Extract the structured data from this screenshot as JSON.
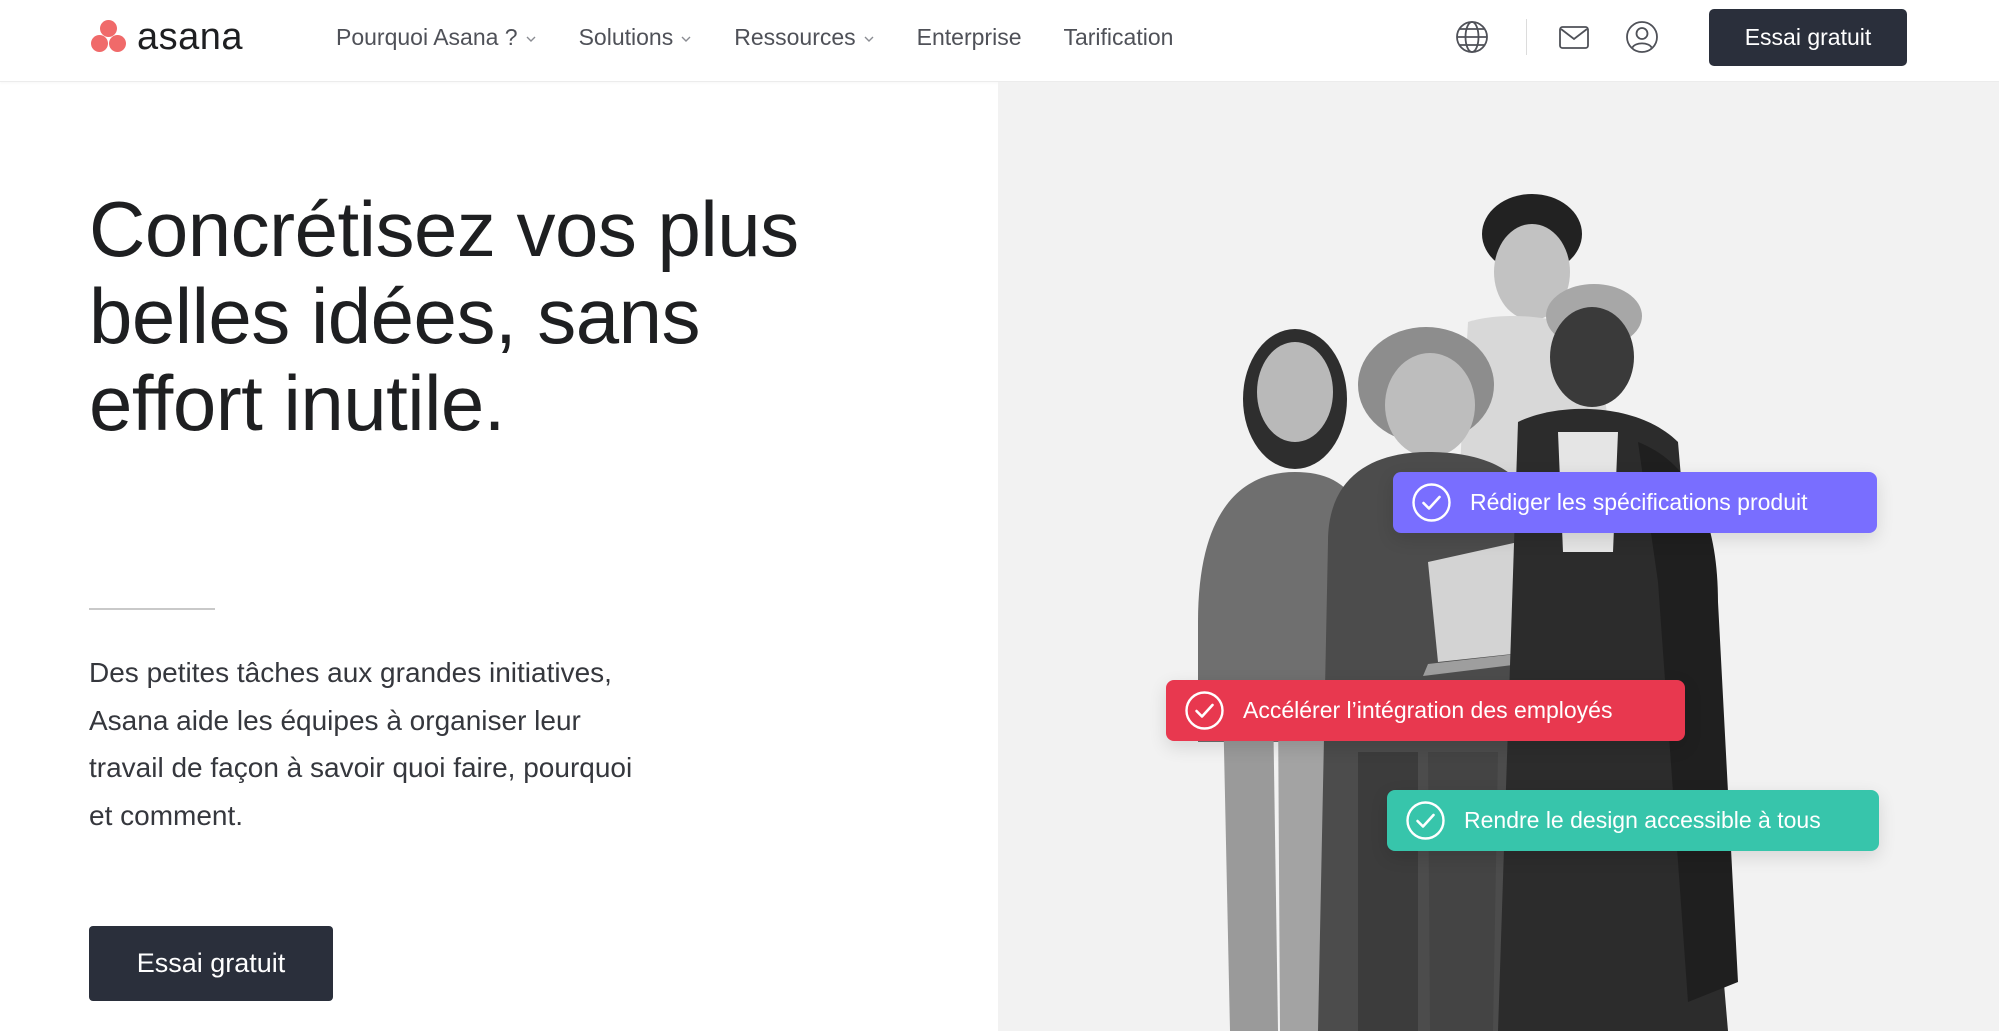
{
  "brand": {
    "name": "asana",
    "accent": "#f06a6a",
    "dark": "#2a2f3b"
  },
  "header": {
    "nav": [
      {
        "label": "Pourquoi Asana ?",
        "dropdown": true
      },
      {
        "label": "Solutions",
        "dropdown": true
      },
      {
        "label": "Ressources",
        "dropdown": true
      },
      {
        "label": "Enterprise",
        "dropdown": false
      },
      {
        "label": "Tarification",
        "dropdown": false
      }
    ],
    "icons": [
      "globe-icon",
      "mail-icon",
      "user-icon"
    ],
    "cta_label": "Essai gratuit"
  },
  "hero": {
    "title": "Concrétisez vos plus belles idées, sans effort inutile.",
    "subtitle": "Des petites tâches aux grandes initiatives, Asana aide les équipes à organiser leur travail de façon à savoir quoi faire, pourquoi et comment.",
    "cta_label": "Essai gratuit"
  },
  "tasks": [
    {
      "label": "Rédiger les spécifications produit",
      "color": "#796eff"
    },
    {
      "label": "Accélérer l’intégration des employés",
      "color": "#e8384f"
    },
    {
      "label": "Rendre le design accessible à tous",
      "color": "#37c5ab"
    }
  ]
}
